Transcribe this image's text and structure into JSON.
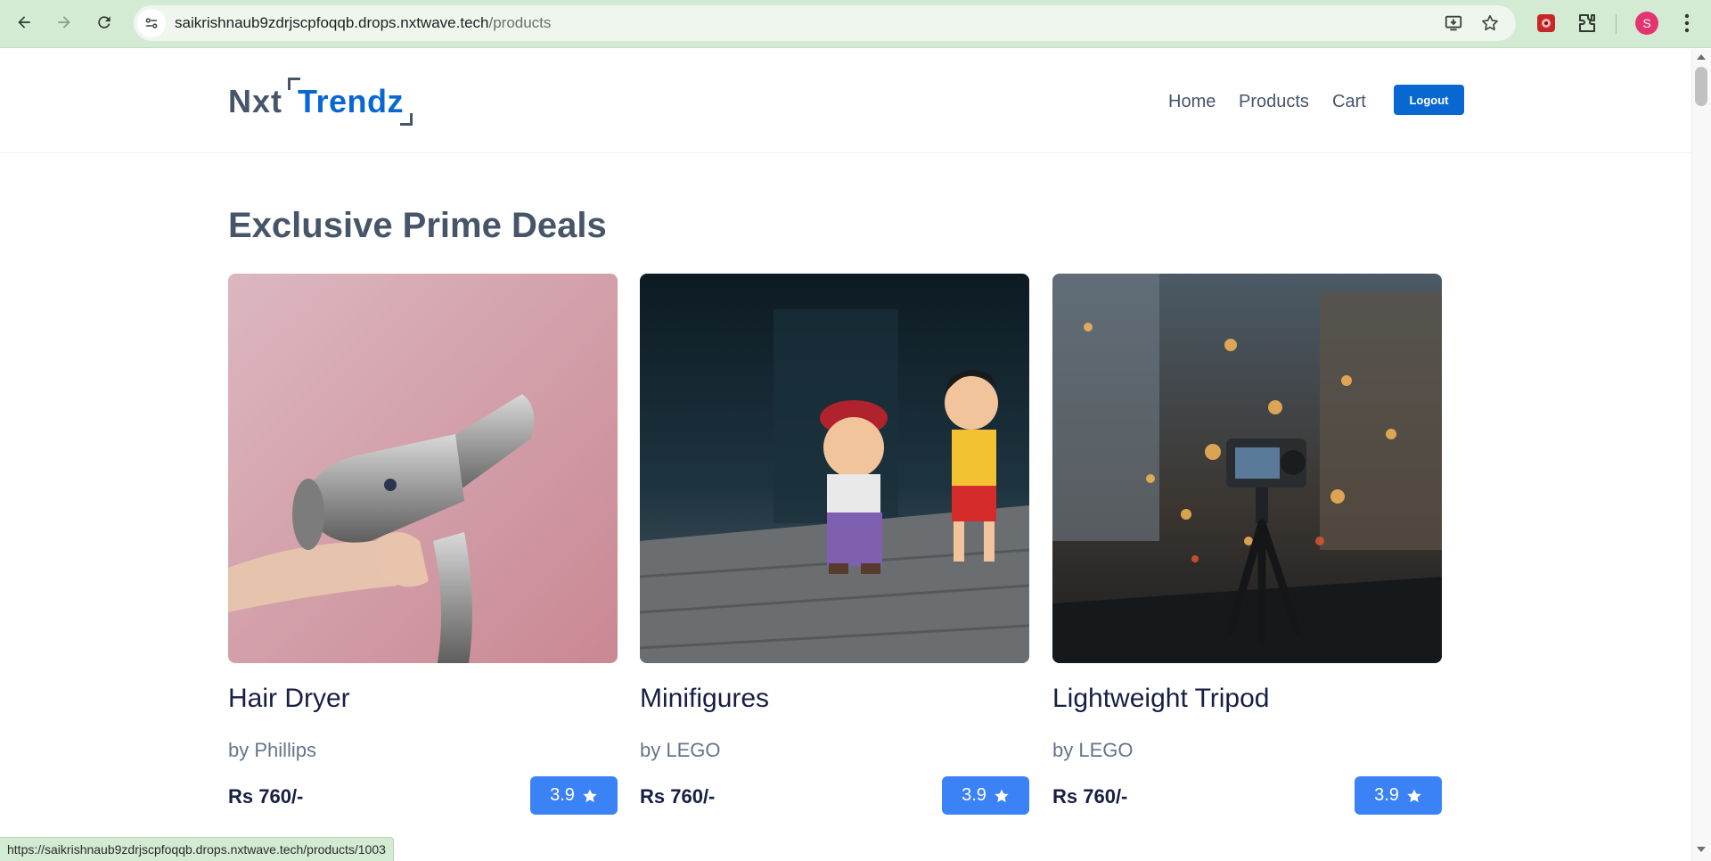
{
  "browser": {
    "url_host": "saikrishnaub9zdrjscpfoqqb.drops.nxtwave.tech",
    "url_path": "/products",
    "profile_initial": "S",
    "status_url": "https://saikrishnaub9zdrjscpfoqqb.drops.nxtwave.tech/products/1003"
  },
  "header": {
    "logo_left": "Nxt",
    "logo_right": "Trendz",
    "nav": {
      "home": "Home",
      "products": "Products",
      "cart": "Cart"
    },
    "logout_label": "Logout"
  },
  "section": {
    "title": "Exclusive Prime Deals"
  },
  "products": [
    {
      "title": "Hair Dryer",
      "brand": "by Phillips",
      "price": "Rs 760/-",
      "rating": "3.9"
    },
    {
      "title": "Minifigures",
      "brand": "by LEGO",
      "price": "Rs 760/-",
      "rating": "3.9"
    },
    {
      "title": "Lightweight Tripod",
      "brand": "by LEGO",
      "price": "Rs 760/-",
      "rating": "3.9"
    }
  ],
  "colors": {
    "brand_blue": "#0967d2",
    "rating_blue": "#3b82f6",
    "heading_gray": "#475569",
    "title_navy": "#171f46",
    "chrome_green": "#d3ead3"
  },
  "icons": [
    "back-icon",
    "forward-icon",
    "reload-icon",
    "site-info-icon",
    "install-app-icon",
    "bookmark-star-icon",
    "extension-icon",
    "puzzle-icon",
    "menu-dots-icon",
    "star-icon"
  ]
}
